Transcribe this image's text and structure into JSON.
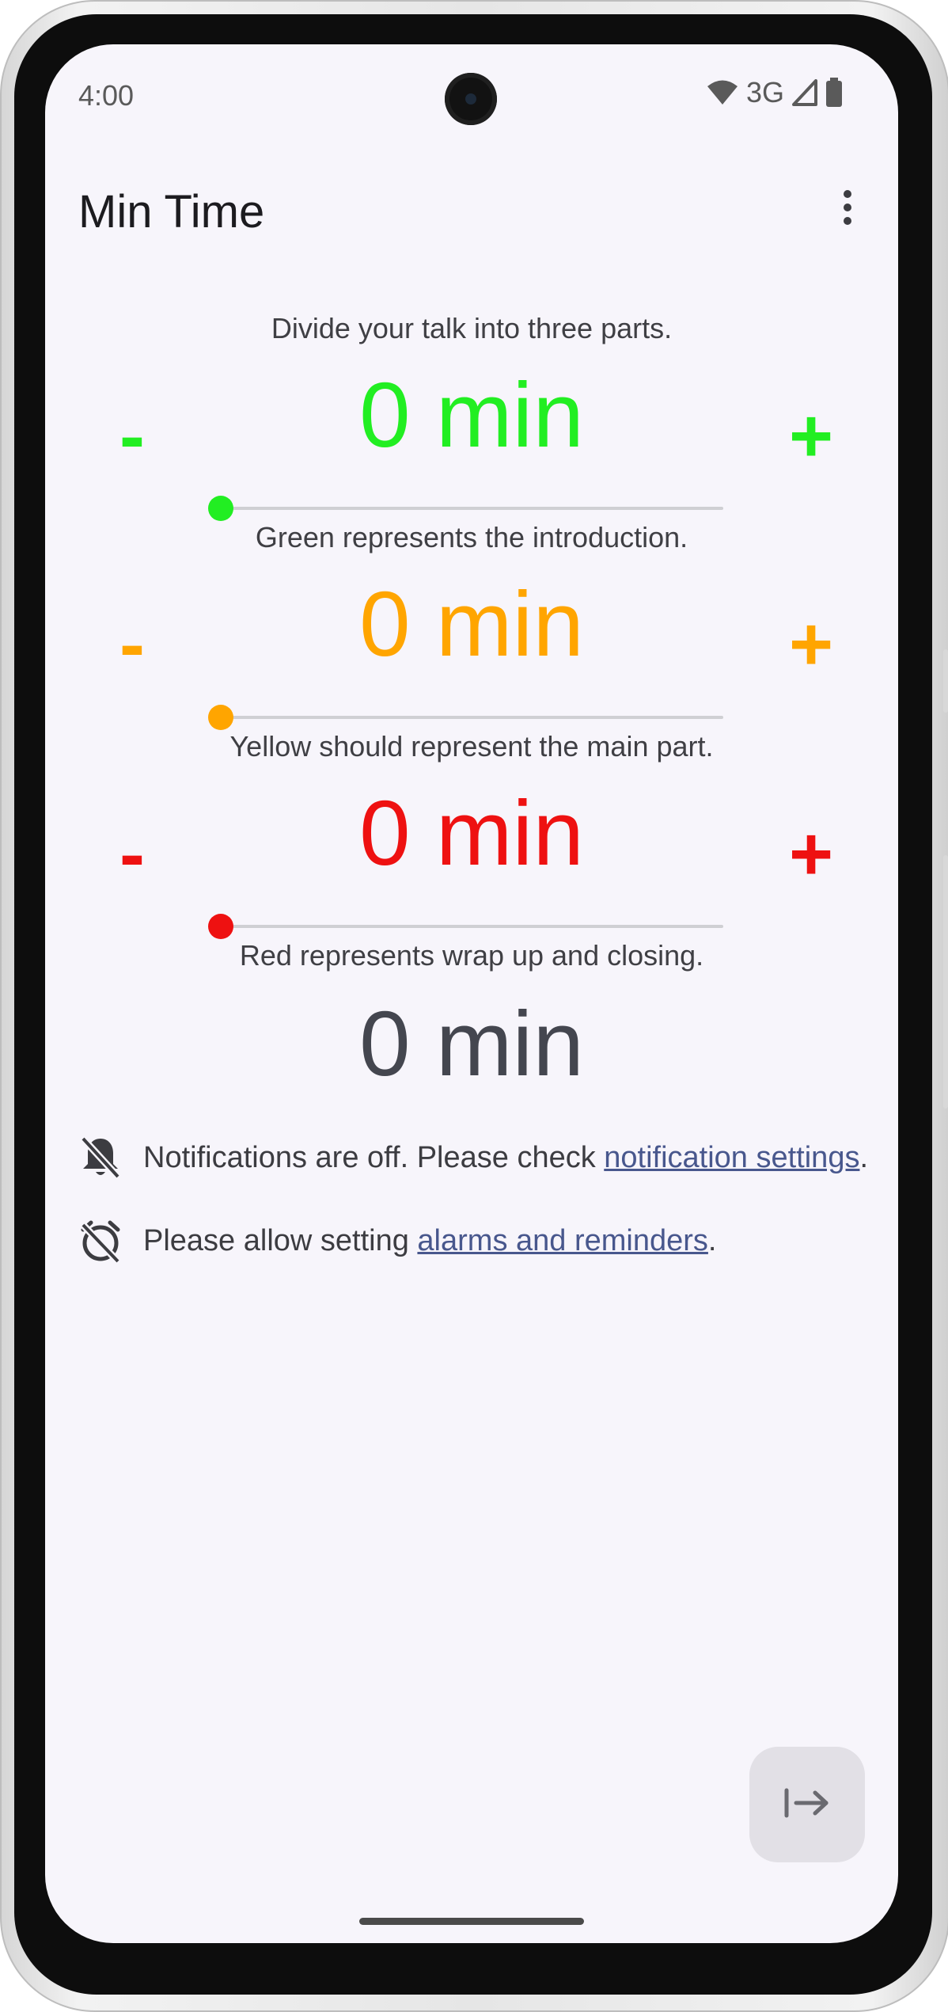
{
  "status_bar": {
    "time": "4:00",
    "network": "3G",
    "icons": [
      "wifi-icon",
      "signal-icon",
      "battery-icon"
    ]
  },
  "app_bar": {
    "title": "Min Time",
    "menu_icon": "more-vert-icon"
  },
  "intro_text": "Divide your talk into three parts.",
  "segments": [
    {
      "name": "green",
      "color": "#22ee22",
      "minutes_text": "0 min",
      "minus_label": "-",
      "plus_label": "+",
      "slider_value": 0,
      "caption": "Green represents the introduction."
    },
    {
      "name": "yellow",
      "color": "#ffa500",
      "minutes_text": "0 min",
      "minus_label": "-",
      "plus_label": "+",
      "slider_value": 0,
      "caption": "Yellow should represent the main part."
    },
    {
      "name": "red",
      "color": "#ee1111",
      "minutes_text": "0 min",
      "minus_label": "-",
      "plus_label": "+",
      "slider_value": 0,
      "caption": "Red represents wrap up and closing."
    }
  ],
  "total_text": "0 min",
  "notices": {
    "notifications": {
      "icon": "notifications-off-icon",
      "prefix": "Notifications are off. Please check ",
      "link": "notification settings",
      "suffix": "."
    },
    "alarms": {
      "icon": "alarm-off-icon",
      "prefix": "Please allow setting ",
      "link": "alarms and reminders",
      "suffix": "."
    }
  },
  "fab": {
    "icon": "start-arrow-icon"
  }
}
